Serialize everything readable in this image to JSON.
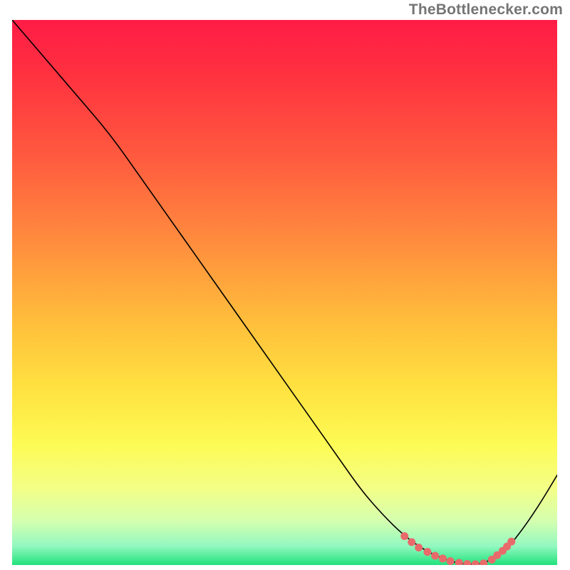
{
  "attribution": "TheBottlenecker.com",
  "chart_data": {
    "type": "line",
    "title": "",
    "xlabel": "",
    "ylabel": "",
    "xlim": [
      0,
      100
    ],
    "ylim": [
      0,
      100
    ],
    "background": {
      "type": "vertical-gradient",
      "stops": [
        {
          "offset": 0.0,
          "color": "#ff1c47"
        },
        {
          "offset": 0.1,
          "color": "#ff313f"
        },
        {
          "offset": 0.25,
          "color": "#ff5a3f"
        },
        {
          "offset": 0.4,
          "color": "#ff8a3e"
        },
        {
          "offset": 0.55,
          "color": "#ffbd3b"
        },
        {
          "offset": 0.68,
          "color": "#ffe341"
        },
        {
          "offset": 0.78,
          "color": "#fdfb55"
        },
        {
          "offset": 0.86,
          "color": "#f3ff87"
        },
        {
          "offset": 0.92,
          "color": "#d4ffb0"
        },
        {
          "offset": 0.965,
          "color": "#93f8c0"
        },
        {
          "offset": 1.0,
          "color": "#21e27c"
        }
      ]
    },
    "series": [
      {
        "name": "bottleneck-curve",
        "color": "#000000",
        "width": 1.6,
        "x": [
          0,
          6,
          12,
          18,
          24,
          30,
          36,
          42,
          48,
          54,
          60,
          64,
          68,
          72,
          76,
          80,
          82,
          84,
          86,
          88,
          91,
          94,
          97,
          100
        ],
        "y": [
          100,
          93,
          86,
          79,
          70.5,
          62,
          53.5,
          45,
          36.5,
          28,
          19.5,
          13.8,
          9.2,
          5.3,
          2.5,
          0.8,
          0.35,
          0.1,
          0.2,
          1.0,
          3.2,
          7.0,
          11.5,
          16.5
        ]
      }
    ],
    "markers": {
      "name": "sweet-spot-dots",
      "color": "#e96a6b",
      "radius": 5.5,
      "points": [
        {
          "x": 72.0,
          "y": 5.3
        },
        {
          "x": 73.3,
          "y": 4.2
        },
        {
          "x": 74.6,
          "y": 3.2
        },
        {
          "x": 76.2,
          "y": 2.4
        },
        {
          "x": 77.6,
          "y": 1.7
        },
        {
          "x": 79.0,
          "y": 1.2
        },
        {
          "x": 80.4,
          "y": 0.7
        },
        {
          "x": 82.0,
          "y": 0.4
        },
        {
          "x": 83.5,
          "y": 0.2
        },
        {
          "x": 85.0,
          "y": 0.15
        },
        {
          "x": 86.5,
          "y": 0.3
        },
        {
          "x": 88.0,
          "y": 1.0
        },
        {
          "x": 89.0,
          "y": 1.8
        },
        {
          "x": 90.0,
          "y": 2.6
        },
        {
          "x": 90.8,
          "y": 3.4
        },
        {
          "x": 91.6,
          "y": 4.3
        }
      ]
    }
  }
}
